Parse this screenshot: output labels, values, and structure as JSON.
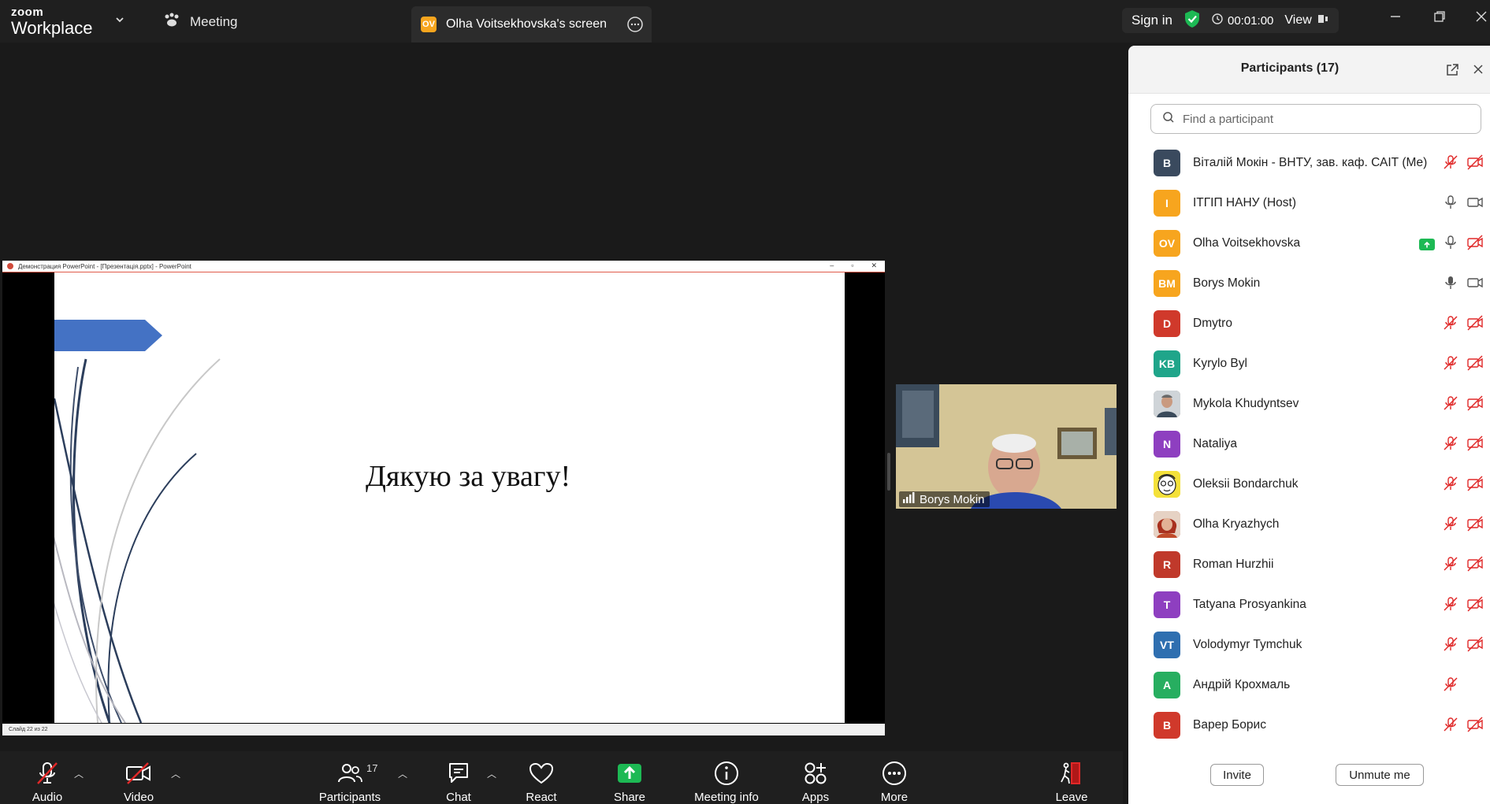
{
  "app": {
    "logo_line1": "zoom",
    "logo_line2": "Workplace"
  },
  "topbar": {
    "meeting_tab": "Meeting",
    "screen_tab_badge": "OV",
    "screen_tab_title": "Olha Voitsekhovska's screen",
    "sign_in": "Sign in",
    "timer": "00:01:00",
    "view": "View"
  },
  "presentation": {
    "window_title": "Демонстрация PowerPoint - [Презентація.pptx] - PowerPoint",
    "slide_text": "Дякую за увагу!",
    "status_text": "Слайд 22 из 22"
  },
  "video_tile": {
    "name": "Borys Mokin"
  },
  "participants_panel": {
    "title": "Participants (17)",
    "search_placeholder": "Find a participant",
    "invite_label": "Invite",
    "unmute_label": "Unmute me",
    "participants": [
      {
        "initials": "B",
        "name": "Віталій Мокін - ВНТУ, зав. каф. САІТ (Me)",
        "color": "#3a4a5e",
        "mic": "muted",
        "video": "off"
      },
      {
        "initials": "I",
        "name": "ІТГІП НАНУ (Host)",
        "color": "#f7a51e",
        "mic": "on",
        "video": "on"
      },
      {
        "initials": "OV",
        "name": "Olha Voitsekhovska",
        "color": "#f7a51e",
        "mic": "on",
        "video": "off",
        "sharing": true
      },
      {
        "initials": "BM",
        "name": "Borys Mokin",
        "color": "#f7a51e",
        "mic": "active",
        "video": "on"
      },
      {
        "initials": "D",
        "name": "Dmytro",
        "color": "#d0392b",
        "mic": "muted",
        "video": "off"
      },
      {
        "initials": "KB",
        "name": "Kyrylo Byl",
        "color": "#1fa58a",
        "mic": "muted",
        "video": "off"
      },
      {
        "initials": "",
        "name": "Mykola Khudyntsev",
        "color": "#8a7a6a",
        "mic": "muted",
        "video": "off",
        "photo": "man-photo"
      },
      {
        "initials": "N",
        "name": "Nataliya",
        "color": "#8e3fc0",
        "mic": "muted",
        "video": "off"
      },
      {
        "initials": "",
        "name": "Oleksii Bondarchuk",
        "color": "#f4e13a",
        "mic": "muted",
        "video": "off",
        "photo": "cartoon-face"
      },
      {
        "initials": "",
        "name": "Olha Kryazhych",
        "color": "#b44a3a",
        "mic": "muted",
        "video": "off",
        "photo": "woman-photo"
      },
      {
        "initials": "R",
        "name": "Roman Hurzhii",
        "color": "#c0392b",
        "mic": "muted",
        "video": "off"
      },
      {
        "initials": "T",
        "name": "Tatyana Prosyankina",
        "color": "#8e3fc0",
        "mic": "muted",
        "video": "off"
      },
      {
        "initials": "VT",
        "name": "Volodymyr Tymchuk",
        "color": "#2f6fb0",
        "mic": "muted",
        "video": "off"
      },
      {
        "initials": "A",
        "name": "Андрій Крохмаль",
        "color": "#27ae60",
        "mic": "muted",
        "video": "none"
      },
      {
        "initials": "B",
        "name": "Варер Борис",
        "color": "#d0392b",
        "mic": "muted",
        "video": "off"
      }
    ]
  },
  "toolbar": {
    "audio": "Audio",
    "video": "Video",
    "participants": "Participants",
    "participants_count": "17",
    "chat": "Chat",
    "react": "React",
    "share": "Share",
    "meeting_info": "Meeting info",
    "apps": "Apps",
    "more": "More",
    "leave": "Leave"
  },
  "colors": {
    "accent_green": "#1db954",
    "muted_red": "#e02828",
    "avatar_orange": "#f7a51e"
  }
}
